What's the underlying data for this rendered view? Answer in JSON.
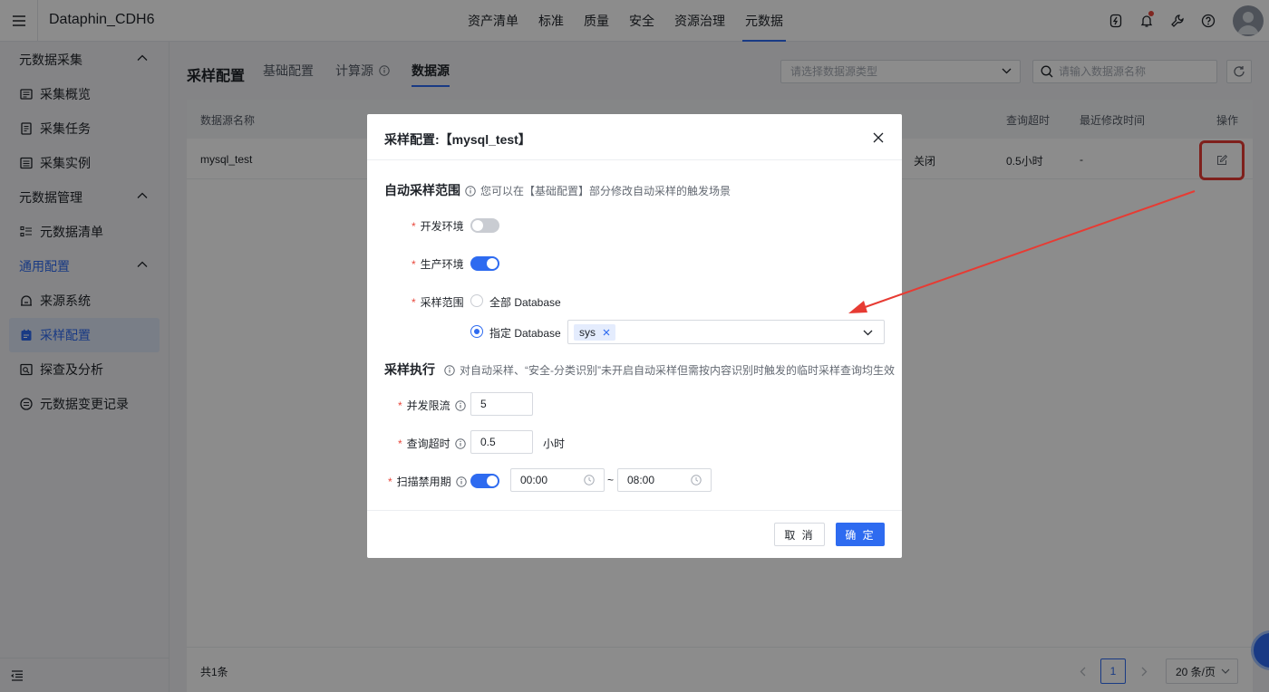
{
  "app": {
    "title": "Dataphin_CDH6"
  },
  "nav": [
    {
      "label": "资产清单"
    },
    {
      "label": "标准"
    },
    {
      "label": "质量"
    },
    {
      "label": "安全"
    },
    {
      "label": "资源治理"
    },
    {
      "label": "元数据",
      "active": true
    }
  ],
  "top_icons": [
    "flash-icon",
    "bell-icon",
    "tools-icon",
    "help-icon",
    "avatar"
  ],
  "sidebar": {
    "groups": [
      {
        "label": "元数据采集",
        "items": [
          {
            "label": "采集概览",
            "icon": "overview-icon"
          },
          {
            "label": "采集任务",
            "icon": "task-icon"
          },
          {
            "label": "采集实例",
            "icon": "instance-icon"
          }
        ]
      },
      {
        "label": "元数据管理",
        "items": [
          {
            "label": "元数据清单",
            "icon": "list-icon"
          }
        ]
      },
      {
        "label": "通用配置",
        "items": [
          {
            "label": "来源系统",
            "icon": "source-icon"
          },
          {
            "label": "采样配置",
            "icon": "sample-icon",
            "active": true
          },
          {
            "label": "探查及分析",
            "icon": "probe-icon"
          },
          {
            "label": "元数据变更记录",
            "icon": "change-icon"
          }
        ]
      }
    ]
  },
  "page": {
    "title": "采样配置",
    "tabs": [
      {
        "label": "基础配置"
      },
      {
        "label": "计算源"
      },
      {
        "label": "数据源",
        "active": true
      }
    ],
    "type_select_placeholder": "请选择数据源类型",
    "search_placeholder": "请输入数据源名称"
  },
  "table": {
    "headers": {
      "name": "数据源名称",
      "timeout": "查询超时",
      "modified": "最近修改时间",
      "action": "操作"
    },
    "rows": [
      {
        "name": "mysql_test",
        "status": "关闭",
        "timeout": "0.5小时",
        "modified": "-"
      }
    ]
  },
  "pager": {
    "total": "共1条",
    "current": "1",
    "page_size": "20 条/页"
  },
  "modal": {
    "title": "采样配置:【mysql_test】",
    "auto_section": {
      "title": "自动采样范围",
      "hint": "您可以在【基础配置】部分修改自动采样的触发场景",
      "dev_label": "开发环境",
      "dev_enabled": false,
      "prod_label": "生产环境",
      "prod_enabled": true,
      "scope_label": "采样范围",
      "scope_all": "全部 Database",
      "scope_specific": "指定 Database",
      "scope_selected": "specific",
      "databases": [
        "sys"
      ]
    },
    "exec_section": {
      "title": "采样执行",
      "hint": "对自动采样、“安全-分类识别”未开启自动采样但需按内容识别时触发的临时采样查询均生效",
      "concurrency_label": "并发限流",
      "concurrency_value": "5",
      "timeout_label": "查询超时",
      "timeout_value": "0.5",
      "timeout_unit": "小时",
      "blackout_label": "扫描禁用期",
      "blackout_enabled": true,
      "blackout_start": "00:00",
      "blackout_end": "08:00",
      "range_sep": "~"
    },
    "buttons": {
      "cancel": "取 消",
      "ok": "确 定"
    }
  },
  "colors": {
    "accent": "#2e6bf0",
    "annotation": "#e73b33"
  }
}
